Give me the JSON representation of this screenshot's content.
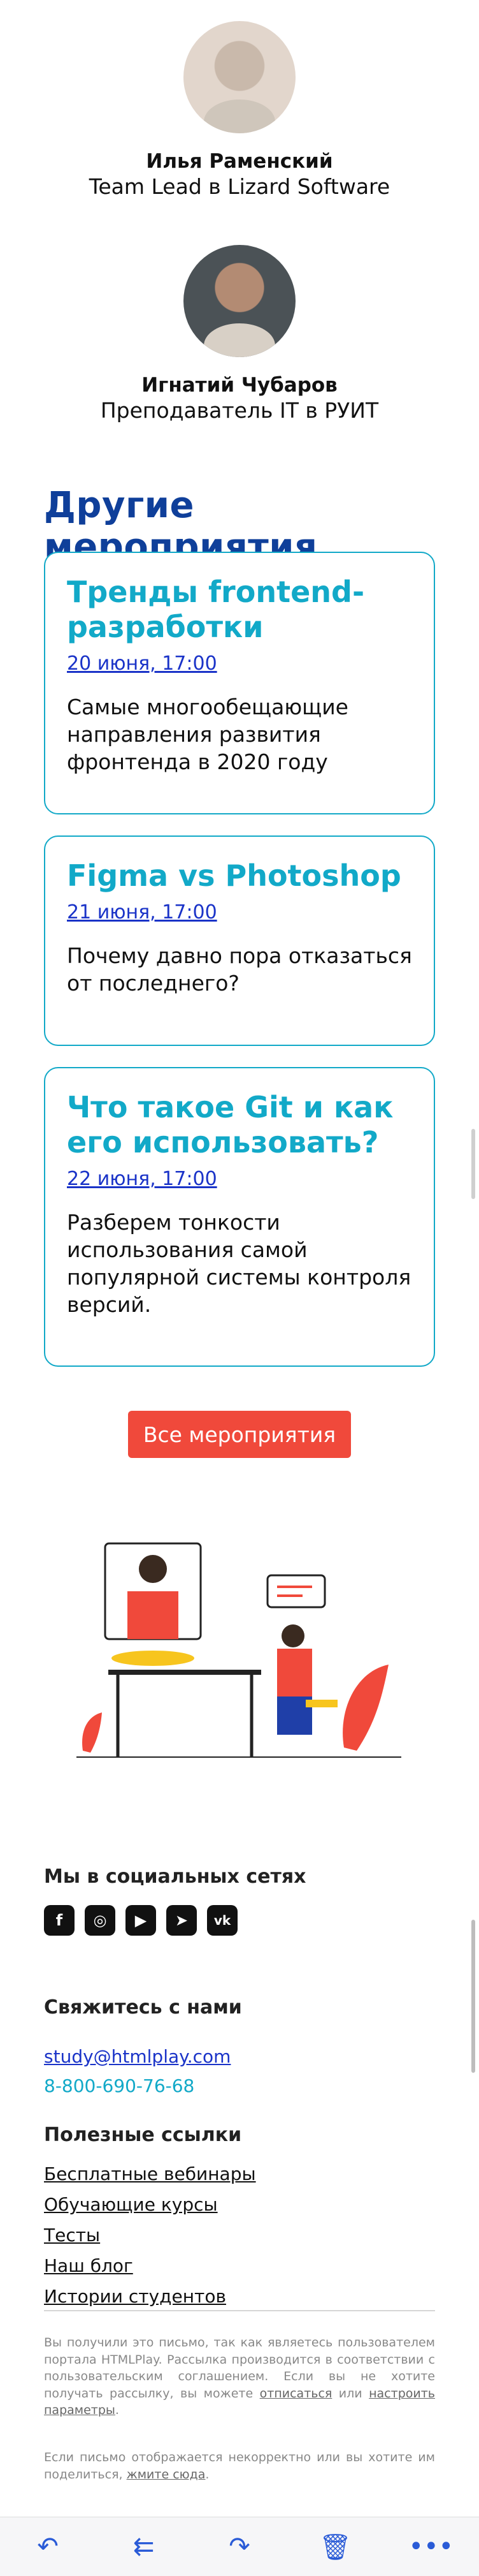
{
  "speakers": [
    {
      "name": "Илья Раменский",
      "role": "Team Lead в Lizard Software"
    },
    {
      "name": "Игнатий Чубаров",
      "role": "Преподаватель IT в РУИТ"
    }
  ],
  "events_section": {
    "title": "Другие мероприятия",
    "cards": [
      {
        "title": "Тренды frontend-разработки",
        "date": "20 июня, 17:00",
        "desc": "Самые многообещающие направления развития фронтенда в 2020 году"
      },
      {
        "title": "Figma vs Photoshop",
        "date": "21 июня, 17:00",
        "desc": "Почему давно пора отказаться от последнего?"
      },
      {
        "title": "Что такое Git и как его использовать?",
        "date": "22 июня, 17:00",
        "desc": "Разберем тонкости использования самой популярной системы контроля версий."
      }
    ],
    "all_button": "Все мероприятия"
  },
  "footer": {
    "social_title": "Мы в социальных сетях",
    "social_icons": [
      "facebook-icon",
      "instagram-icon",
      "youtube-icon",
      "telegram-icon",
      "vk-icon"
    ],
    "contact_title": "Свяжитесь с нами",
    "email": "study@htmlplay.com",
    "phone": "8-800-690-76-68",
    "links_title": "Полезные ссылки",
    "links": [
      "Бесплатные вебинары",
      "Обучающие курсы",
      "Тесты",
      "Наш блог",
      "Истории студентов"
    ],
    "legal_1_a": "Вы получили это письмо, так как являетесь пользователем портала HTMLPlay. Рассылка производится в соответствии с пользовательским соглашением. Если вы не хотите получать рассылку, вы можете ",
    "legal_1_link1": "отписаться",
    "legal_1_b": " или ",
    "legal_1_link2": "настроить параметры",
    "legal_1_c": ".",
    "legal_2_a": "Если письмо отображается некорректно или вы хотите им поделиться, ",
    "legal_2_link": "жмите сюда",
    "legal_2_b": "."
  },
  "colors": {
    "accent": "#12a9c8",
    "title": "#0f3f9a",
    "button": "#f0493b",
    "link": "#1a33c8"
  },
  "toolbar": {
    "icons": [
      "reply-icon",
      "reply-all-icon",
      "forward-icon",
      "trash-icon",
      "more-icon"
    ]
  }
}
